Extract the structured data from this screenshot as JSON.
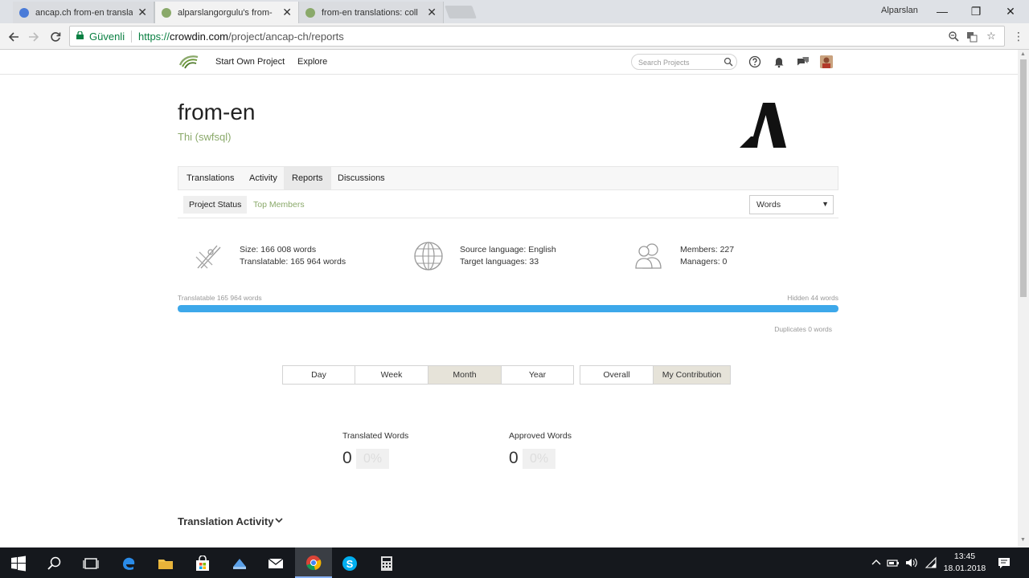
{
  "browser": {
    "tabs": [
      {
        "label": "ancap.ch from-en transla",
        "color": "#4a7bd8"
      },
      {
        "label": "alparslangorgulu's from-",
        "color": "#8aa96a"
      },
      {
        "label": "from-en translations: coll",
        "color": "#8aa96a"
      }
    ],
    "profile_name": "Alparslan",
    "secure_label": "Güvenli",
    "url_proto": "https://",
    "url_host": "crowdin.com",
    "url_path": "/project/ancap-ch/reports"
  },
  "site": {
    "nav": {
      "start_project": "Start Own Project",
      "explore": "Explore"
    },
    "search_placeholder": "Search Projects"
  },
  "project": {
    "title": "from-en",
    "subtitle": "Thi (swfsql)",
    "tabs": [
      "Translations",
      "Activity",
      "Reports",
      "Discussions"
    ],
    "subtabs": {
      "project_status": "Project Status",
      "top_members": "Top Members"
    },
    "unit_select": "Words",
    "stats": {
      "size": "Size: 166 008 words",
      "translatable": "Translatable: 165 964 words",
      "source_language": "Source language: English",
      "target_languages": "Target languages: 33",
      "members": "Members: 227",
      "managers": "Managers: 0"
    },
    "progress": {
      "left_label": "Translatable 165 964 words",
      "right_label": "Hidden 44 words",
      "duplicates_label": "Duplicates 0 words",
      "translatable_fraction": 0.9997
    },
    "periods": [
      "Day",
      "Week",
      "Month",
      "Year"
    ],
    "active_period": "Month",
    "scopes": [
      "Overall",
      "My Contribution"
    ],
    "active_scope": "My Contribution",
    "counters": {
      "translated_label": "Translated Words",
      "translated_value": "0",
      "translated_pct": "0%",
      "approved_label": "Approved Words",
      "approved_value": "0",
      "approved_pct": "0%"
    },
    "activity_title": "Translation Activity"
  },
  "taskbar": {
    "time": "13:45",
    "date": "18.01.2018"
  },
  "colors": {
    "accent_green": "#8aa96a",
    "progress_blue": "#3da8ea",
    "secure_green": "#0b8043"
  }
}
